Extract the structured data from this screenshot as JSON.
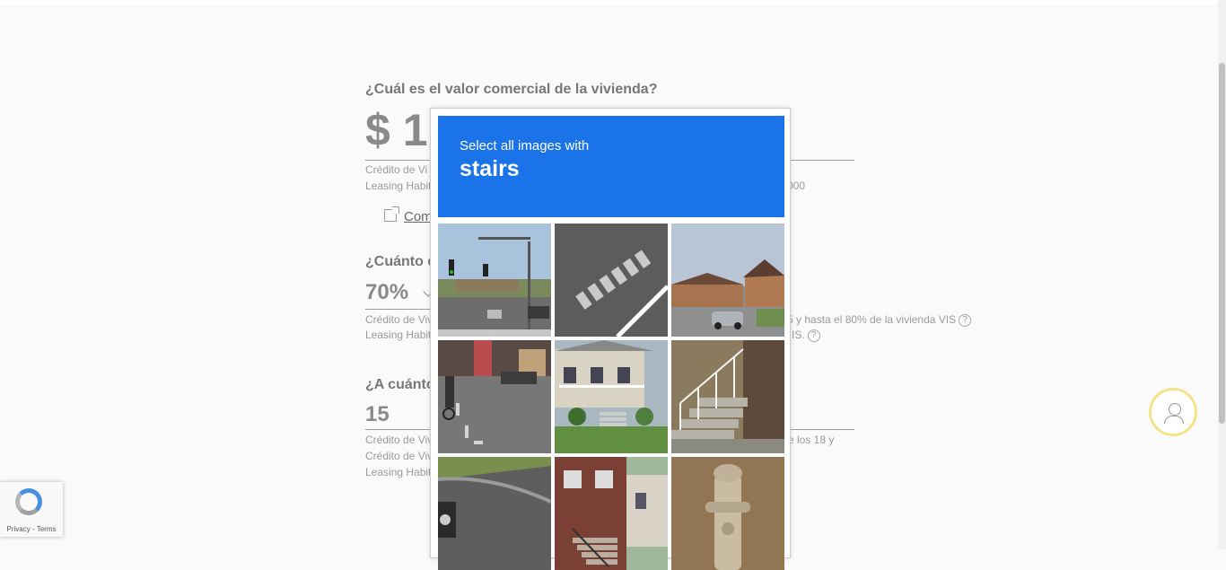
{
  "form": {
    "q1_title": "¿Cuál es el valor comercial de la vivienda?",
    "q1_value": "$ 1",
    "q1_hint_line1": "Crédito de Vi",
    "q1_hint_line2": "Leasing Habit",
    "q1_hint_tail": "000",
    "q1_link": "Com",
    "q2_title": "¿Cuánto d",
    "q2_value": "70%",
    "q2_hint_line1": "Crédito de Viv",
    "q2_hint_line2": "Leasing Habit",
    "q2_hint_tail1": "5 y hasta el 80% de la vivienda VIS",
    "q2_hint_tail2": "IS.",
    "q3_title": "¿A cuánto",
    "q3_value": "15",
    "q3_hint_line1": "Crédito de Viv",
    "q3_hint_line2": "Crédito de Viv",
    "q3_hint_line3": "Leasing Habit",
    "q3_hint_tail": "re los 18 y",
    "help_glyph": "?"
  },
  "captcha": {
    "instruction": "Select all images with",
    "target": "stairs",
    "tiles": [
      "traffic-lights-street",
      "crosswalk-road",
      "house-with-car",
      "bike-lane-street",
      "house-with-porch-stairs",
      "outdoor-stairs-railing",
      "street-corner-car",
      "brick-house-stairs",
      "fire-hydrant"
    ]
  },
  "recaptcha_badge": {
    "links": "Privacy - Terms"
  },
  "icons": {
    "external_link": "external-link-icon",
    "dropdown": "chevron-down-icon",
    "help": "support-agent-icon",
    "recaptcha": "recaptcha-logo-icon"
  },
  "colors": {
    "captcha_blue": "#1a73e8",
    "help_ring": "#f4e38a"
  }
}
